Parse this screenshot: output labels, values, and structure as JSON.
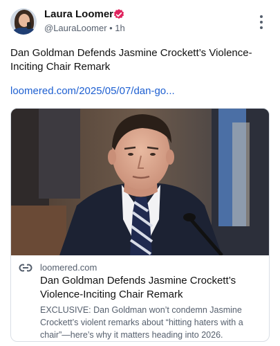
{
  "post": {
    "author_name": "Laura Loomer",
    "handle_line": "@LauraLoomer • 1h",
    "text": "Dan Goldman Defends Jasmine Crockett’s Violence-Inciting Chair Remark",
    "link": "loomered.com/2025/05/07/dan-go...",
    "verified_color": "#e0245e"
  },
  "card": {
    "domain": "loomered.com",
    "title": "Dan Goldman Defends Jasmine Crockett’s Violence-Inciting Chair Remark",
    "description": "EXCLUSIVE: Dan Goldman won’t condemn Jasmine Crockett’s violent remarks about “hitting haters with a chair”—here’s why it matters heading into 2026."
  },
  "icons": {
    "verified": "verified-badge-icon",
    "more": "more-vertical-icon",
    "link": "link-icon"
  }
}
